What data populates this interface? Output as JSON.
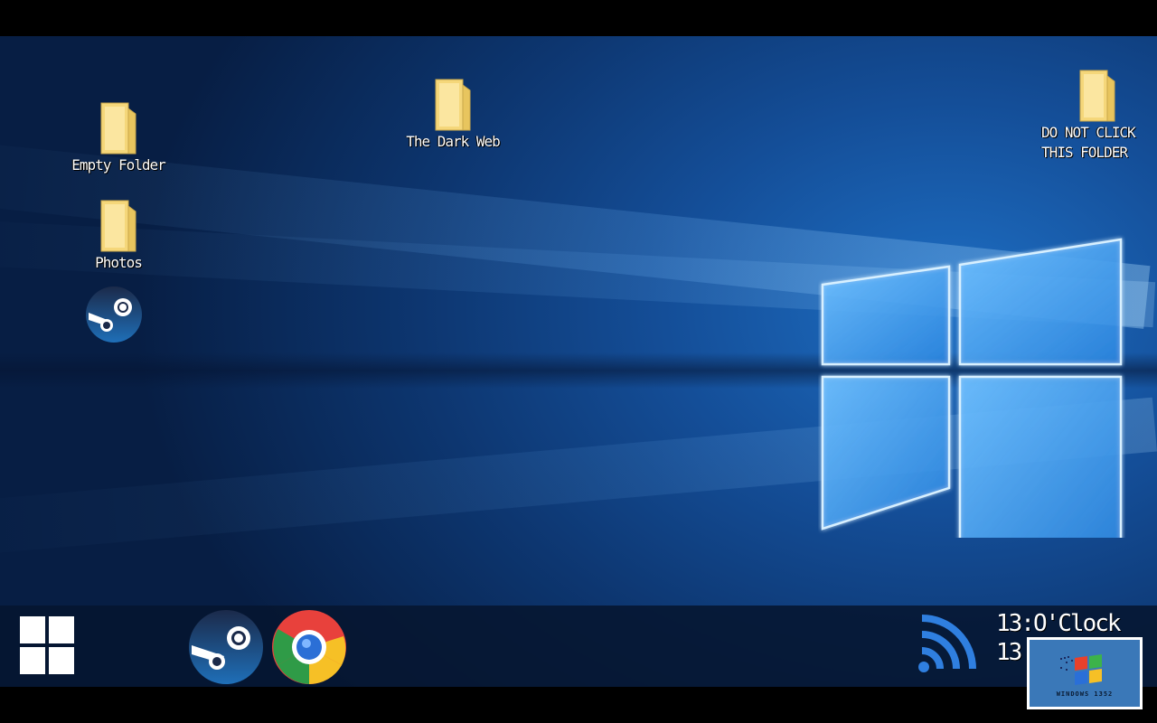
{
  "desktop": {
    "icons": [
      {
        "label": "Empty Folder",
        "icon": "folder-icon"
      },
      {
        "label": "The Dark Web",
        "icon": "folder-icon"
      },
      {
        "label": "Photos",
        "icon": "folder-icon"
      },
      {
        "label_line1": "DO NOT CLICK",
        "label_line2": "THIS FOLDER",
        "icon": "folder-icon"
      }
    ],
    "shortcut": {
      "icon": "steam-icon"
    }
  },
  "taskbar": {
    "start": {
      "icon": "windows-start-icon"
    },
    "apps": [
      {
        "icon": "steam-icon"
      },
      {
        "icon": "chrome-icon"
      }
    ],
    "network": {
      "icon": "wifi-icon"
    },
    "clock": {
      "time": "13:O'Clock",
      "date": "13"
    }
  },
  "badge": {
    "label": "WINDOWS 1352",
    "icon": "windows-flag-icon"
  },
  "colors": {
    "wallpaper": "#144e98",
    "taskbar": "#061630",
    "folder": "#f5d77a",
    "text": "#ffffff"
  }
}
